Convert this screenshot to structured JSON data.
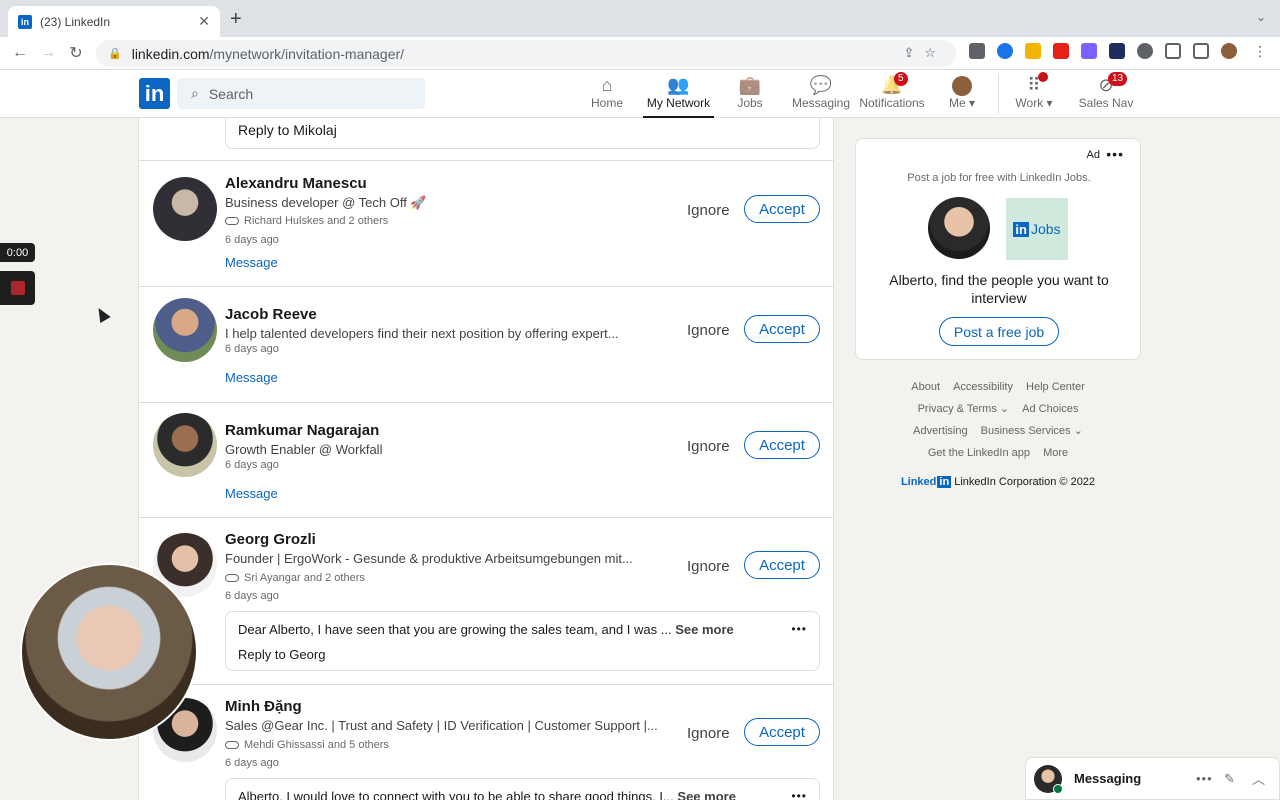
{
  "browser": {
    "tab_title": "(23) LinkedIn",
    "url_host": "linkedin.com",
    "url_path": "/mynetwork/invitation-manager/"
  },
  "header": {
    "logo": "in",
    "search_placeholder": "Search",
    "nav": [
      {
        "label": "Home",
        "icon": "home-icon"
      },
      {
        "label": "My Network",
        "icon": "network-icon",
        "active": true
      },
      {
        "label": "Jobs",
        "icon": "briefcase-icon"
      },
      {
        "label": "Messaging",
        "icon": "chat-icon"
      },
      {
        "label": "Notifications",
        "icon": "bell-icon",
        "badge": "5"
      },
      {
        "label": "Me",
        "icon": "avatar"
      },
      {
        "label": "Work",
        "icon": "grid-icon"
      },
      {
        "label": "Sales Nav",
        "icon": "compass-icon",
        "badge": "13"
      }
    ]
  },
  "top_reply": "Reply to Mikolaj",
  "invitations": [
    {
      "name": "Alexandru Manescu",
      "headline": "Business developer @ Tech Off 🚀",
      "mutual": "Richard Hulskes and 2 others",
      "time": "6 days ago",
      "message_link": "Message",
      "ignore": "Ignore",
      "accept": "Accept"
    },
    {
      "name": "Jacob Reeve",
      "headline": "I help talented developers find their next position by offering expert...",
      "time": "6 days ago",
      "message_link": "Message",
      "ignore": "Ignore",
      "accept": "Accept"
    },
    {
      "name": "Ramkumar Nagarajan",
      "headline": "Growth Enabler @ Workfall",
      "time": "6 days ago",
      "message_link": "Message",
      "ignore": "Ignore",
      "accept": "Accept"
    },
    {
      "name": "Georg Grozli",
      "headline": "Founder | ErgoWork - Gesunde & produktive Arbeitsumgebungen mit...",
      "mutual": "Sri Ayangar and 2 others",
      "time": "6 days ago",
      "message": "Dear Alberto, I have seen that you are growing the sales team, and I was ...",
      "see_more": "See more",
      "reply": "Reply to Georg",
      "ignore": "Ignore",
      "accept": "Accept"
    },
    {
      "name": "Minh Đặng",
      "headline": "Sales @Gear Inc. | Trust and Safety | ID Verification | Customer Support |...",
      "mutual": "Mehdi Ghissassi and 5 others",
      "time": "6 days ago",
      "message": "Alberto, I would love to connect with you to be able to share good things. I...",
      "see_more": "See more",
      "ignore": "Ignore",
      "accept": "Accept"
    }
  ],
  "ad": {
    "label": "Ad",
    "tagline": "Post a job for free with LinkedIn Jobs.",
    "jobs_logo_in": "in",
    "jobs_logo_text": "Jobs",
    "copy": "Alberto, find the people you want to interview",
    "cta": "Post a free job"
  },
  "footer": {
    "links": [
      "About",
      "Accessibility",
      "Help Center",
      "Privacy & Terms ⌄",
      "Ad Choices",
      "Advertising",
      "Business Services ⌄",
      "Get the LinkedIn app",
      "More"
    ],
    "brand": "Linked",
    "brand_in": "in",
    "copyright": "LinkedIn Corporation © 2022"
  },
  "recorder": {
    "timer": "0:00"
  },
  "messaging": {
    "label": "Messaging"
  }
}
